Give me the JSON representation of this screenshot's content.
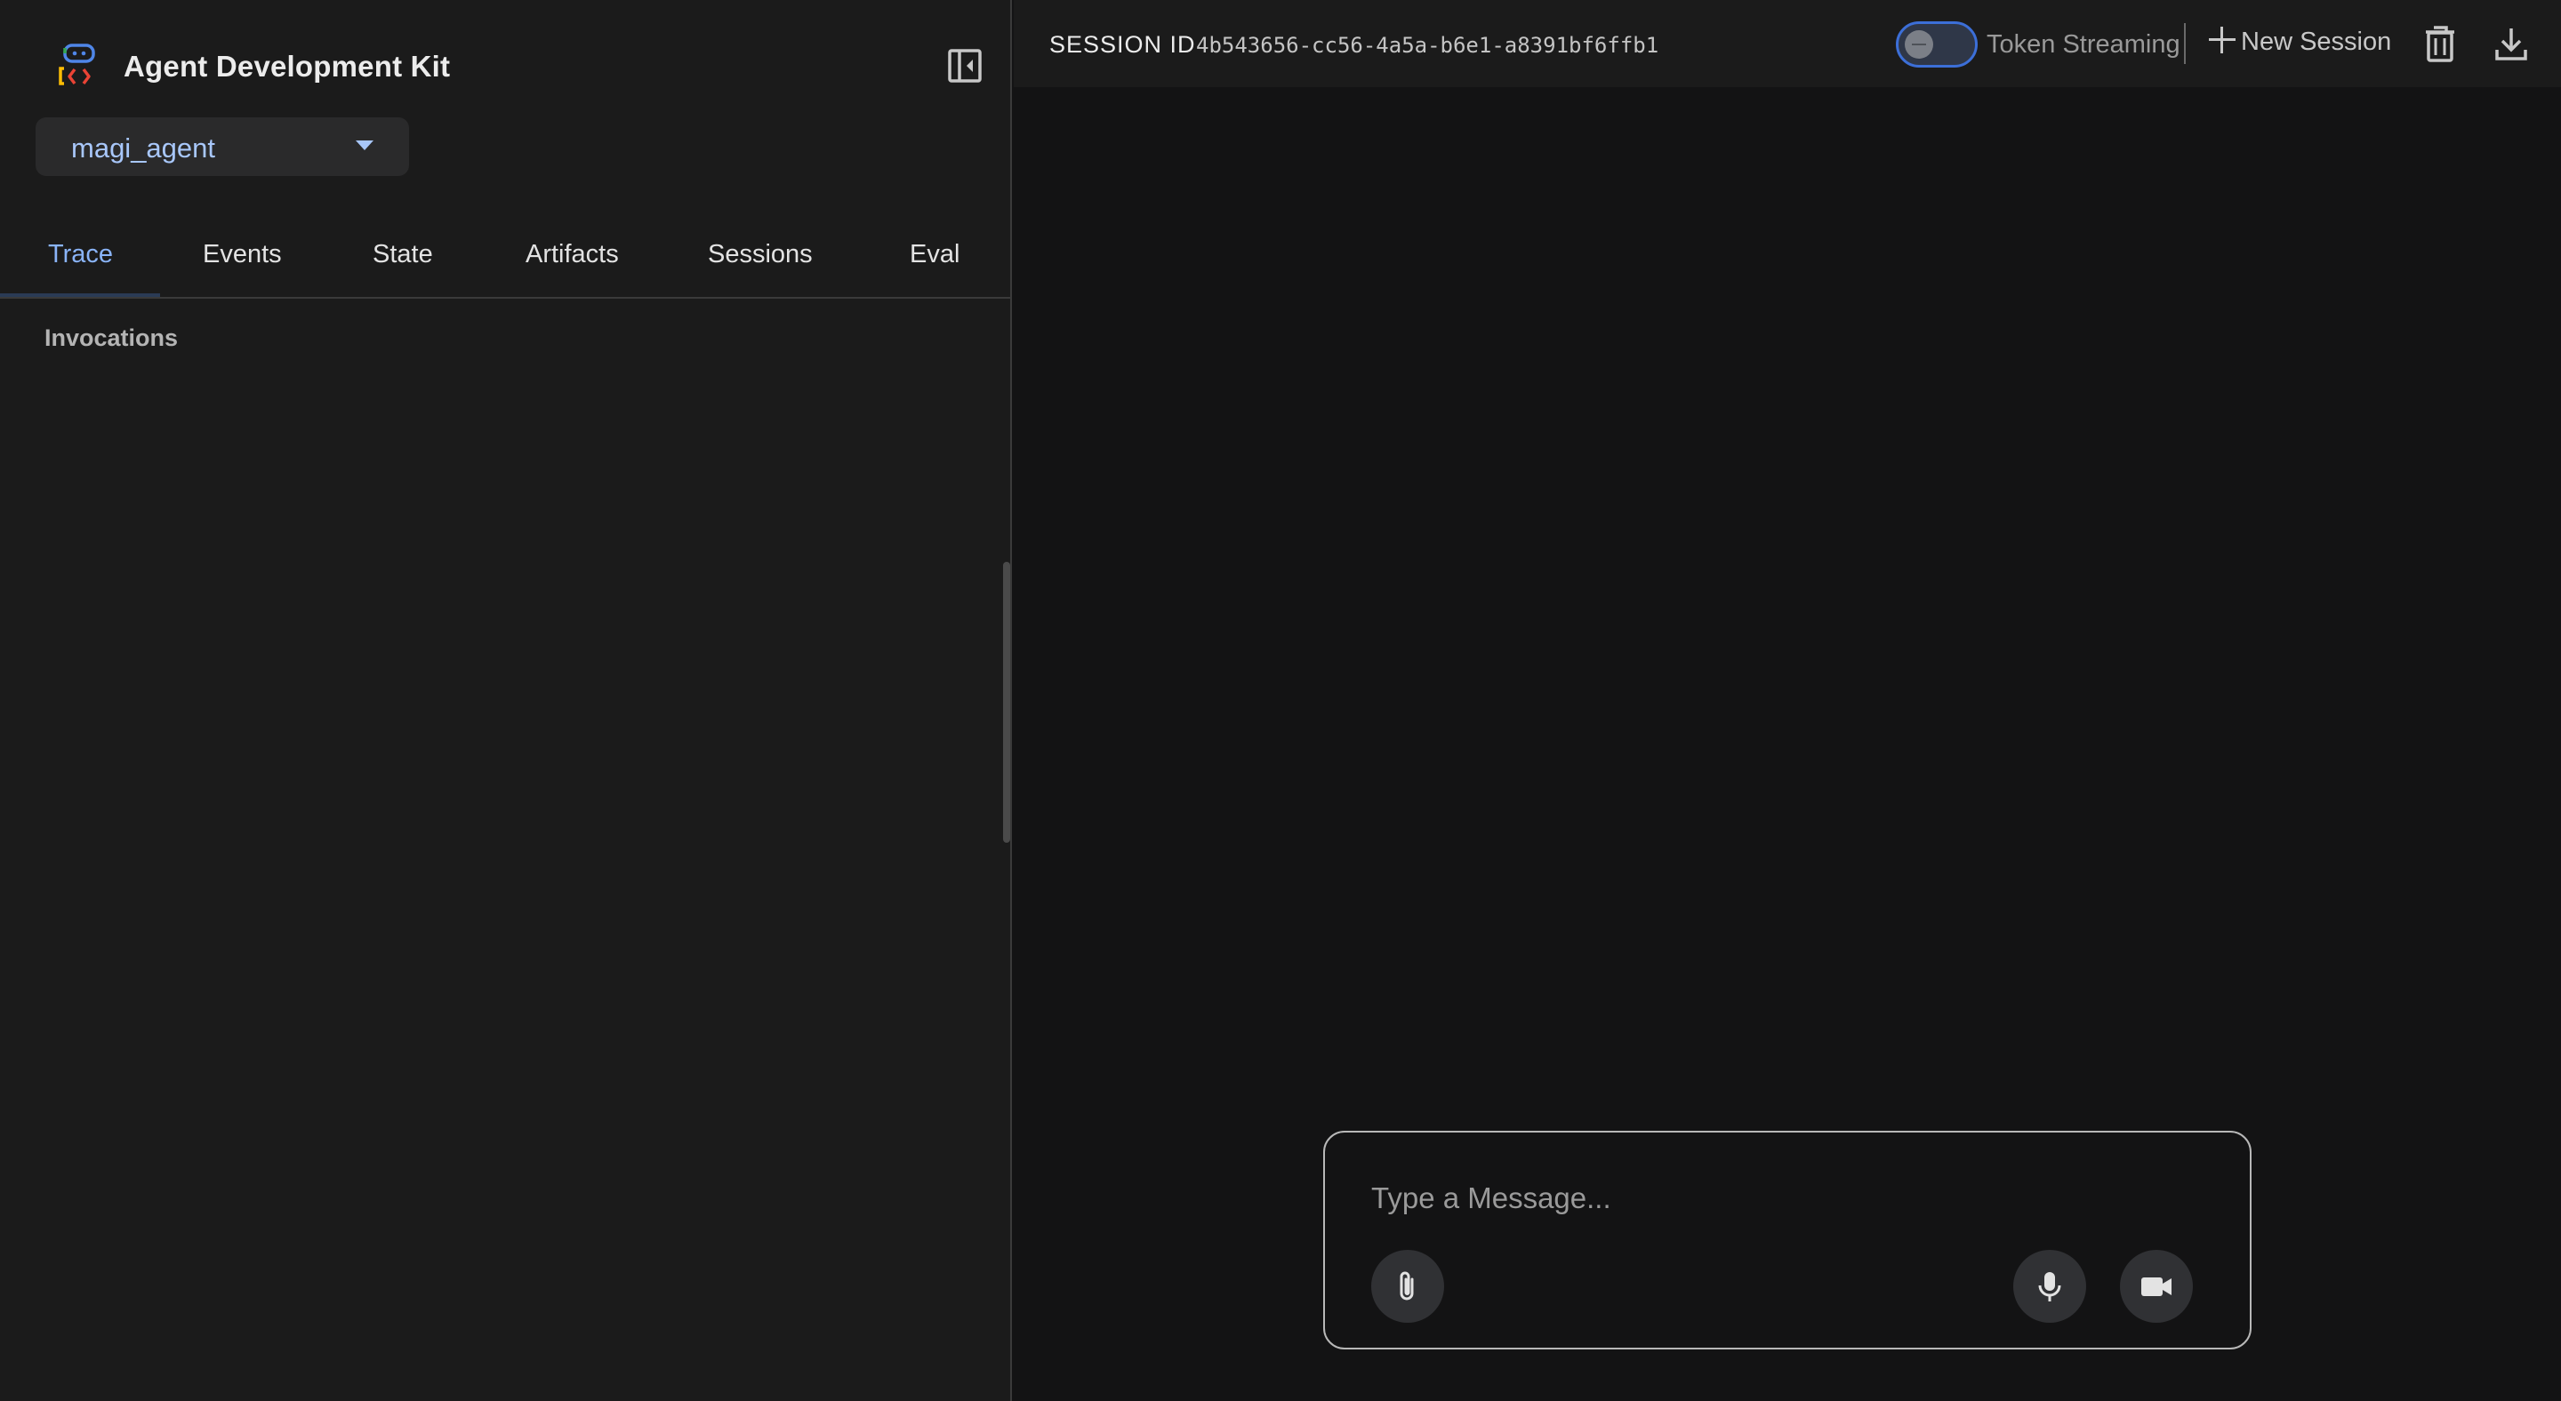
{
  "app": {
    "title": "Agent Development Kit",
    "logo_icon": "adk-logo-icon",
    "collapse_icon": "collapse-panel-icon"
  },
  "agent_selector": {
    "selected": "magi_agent",
    "icon": "dropdown-arrow-icon"
  },
  "tabs": [
    {
      "label": "Trace",
      "active": true
    },
    {
      "label": "Events",
      "active": false
    },
    {
      "label": "State",
      "active": false
    },
    {
      "label": "Artifacts",
      "active": false
    },
    {
      "label": "Sessions",
      "active": false
    },
    {
      "label": "Eval",
      "active": false
    }
  ],
  "trace": {
    "section_title": "Invocations"
  },
  "header": {
    "session_label": "SESSION ID",
    "session_id": "4b543656-cc56-4a5a-b6e1-a8391bf6ffb1",
    "token_streaming_label": "Token Streaming",
    "token_streaming_enabled": false,
    "new_session_label": "New Session",
    "icons": [
      "plus-icon",
      "delete-icon",
      "download-icon"
    ]
  },
  "composer": {
    "placeholder": "Type a Message...",
    "value": "",
    "icons": [
      "attach-icon",
      "microphone-icon",
      "video-camera-icon"
    ]
  },
  "colors": {
    "accent": "#8ab4f8",
    "sidebar_bg": "#1b1b1b",
    "main_bg": "#131314",
    "toggle_border": "#3c6fd8"
  }
}
